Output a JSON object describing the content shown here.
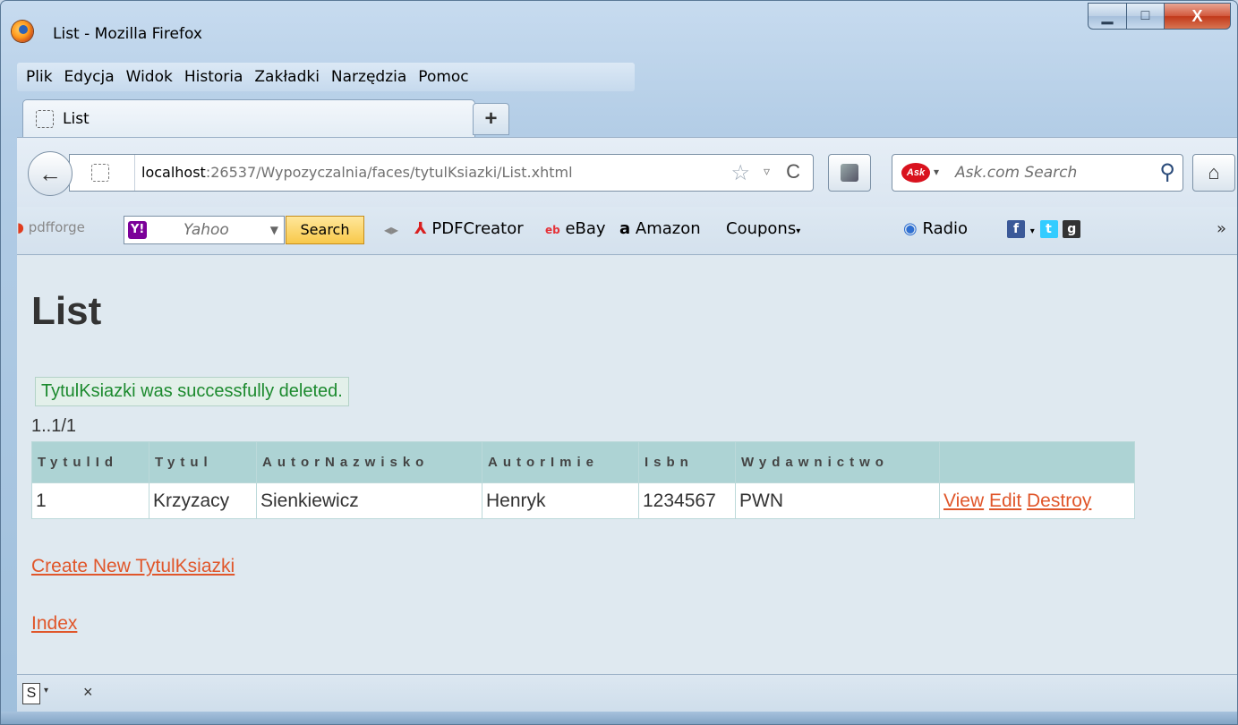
{
  "window": {
    "title": "List - Mozilla Firefox",
    "controls": {
      "minimize": "▁",
      "maximize": "□",
      "close": "X"
    }
  },
  "menu": [
    "Plik",
    "Edycja",
    "Widok",
    "Historia",
    "Zakładki",
    "Narzędzia",
    "Pomoc"
  ],
  "tab": {
    "label": "List",
    "new_tab": "+"
  },
  "nav": {
    "back": "←",
    "url_host": "localhost",
    "url_rest": ":26537/Wypozyczalnia/faces/tytulKsiazki/List.xhtml",
    "star": "☆",
    "dropdown": "▿",
    "reload": "C",
    "search_logo": "Ask",
    "search_placeholder": "Ask.com Search",
    "search_icon": "⚲",
    "home": "⌂"
  },
  "bookmarks": {
    "pdfforge": "pdfforge",
    "yahoo_logo": "Y!",
    "yahoo_placeholder": "Yahoo",
    "yahoo_search": "Search",
    "items": [
      "PDFCreator",
      "eBay",
      "Amazon",
      "Coupons",
      "Radio"
    ],
    "overflow": "»"
  },
  "page": {
    "title": "List",
    "message": "TytulKsiazki was successfully deleted.",
    "counter": "1..1/1",
    "table": {
      "headers": [
        "TytulId",
        "Tytul",
        "AutorNazwisko",
        "AutorImie",
        "Isbn",
        "Wydawnictwo",
        ""
      ],
      "rows": [
        {
          "cells": [
            "1",
            "Krzyzacy",
            "Sienkiewicz",
            "Henryk",
            "1234567",
            "PWN"
          ],
          "actions": [
            "View",
            "Edit",
            "Destroy"
          ]
        }
      ]
    },
    "create_link": "Create New TytulKsiazki",
    "index_link": "Index"
  },
  "statusbar": {
    "icon_label": "S",
    "close": "×"
  }
}
